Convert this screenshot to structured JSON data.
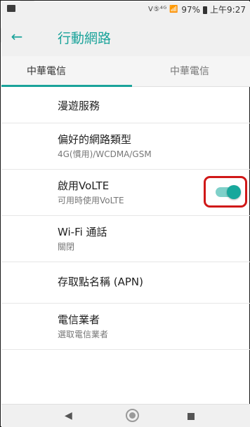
{
  "status_bar": {
    "icons_text": "V⑤⁴ᴳ 📶",
    "battery": "97%",
    "time": "上午9:27"
  },
  "app_bar": {
    "back_icon": "arrow-left",
    "title": "行動網路"
  },
  "tabs": [
    {
      "label": "中華電信",
      "selected": true
    },
    {
      "label": "中華電信",
      "selected": false
    }
  ],
  "settings": [
    {
      "title": "漫遊服務",
      "subtitle": ""
    },
    {
      "title": "偏好的網路類型",
      "subtitle": "4G(慣用)/WCDMA/GSM"
    },
    {
      "title": "啟用VoLTE",
      "subtitle": "可用時使用VoLTE",
      "toggle": true
    },
    {
      "title": "Wi-Fi 通話",
      "subtitle": "關閉"
    },
    {
      "title": "存取點名稱 (APN)",
      "subtitle": ""
    },
    {
      "title": "電信業者",
      "subtitle": "選取電信業者"
    }
  ],
  "colors": {
    "accent": "#1aa39a",
    "highlight": "#d01818"
  }
}
